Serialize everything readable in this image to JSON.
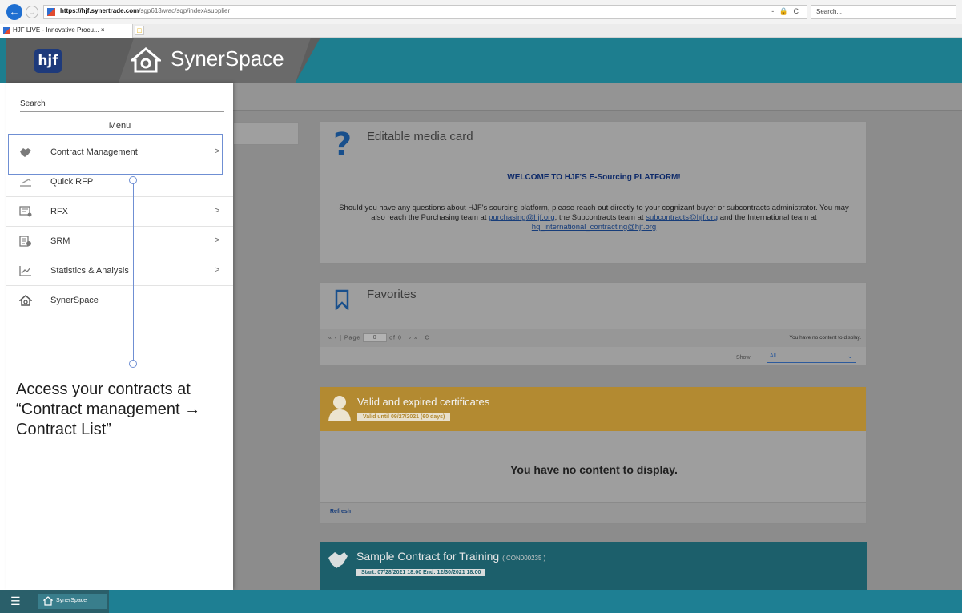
{
  "browser": {
    "url_host": "https://hjf.synertrade.com",
    "url_path": "/sgp613/wac/sqp/index#supplier",
    "address_controls": "- 🔒 C",
    "search_placeholder": "Search...",
    "tab_title": "HJF LIVE - Innovative Procu...",
    "tab_close": "×"
  },
  "header": {
    "logo_text": "hjf",
    "app_title": "SynerSpace",
    "accent_color": "#1d7e8f"
  },
  "side_menu": {
    "search_label": "Search",
    "heading": "Menu",
    "items": [
      {
        "label": "Contract Management",
        "icon": "handshake-icon",
        "has_submenu": true
      },
      {
        "label": "Quick RFP",
        "icon": "quick-rfp-icon",
        "has_submenu": false
      },
      {
        "label": "RFX",
        "icon": "rfx-icon",
        "has_submenu": true
      },
      {
        "label": "SRM",
        "icon": "srm-icon",
        "has_submenu": true
      },
      {
        "label": "Statistics & Analysis",
        "icon": "chart-icon",
        "has_submenu": true
      },
      {
        "label": "SynerSpace",
        "icon": "home-icon",
        "has_submenu": false
      }
    ],
    "chevron": ">"
  },
  "callout": {
    "text": "Access your contracts at\n“Contract management →\nContract List”",
    "color": "#6f8fd3"
  },
  "media_card": {
    "title": "Editable media card",
    "icon_glyph": "?",
    "welcome": "WELCOME TO HJF'S E-Sourcing PLATFORM!",
    "body_1": "Should you have any questions about HJF's sourcing platform, please reach out directly to your cognizant buyer or subcontracts administrator.  You may also reach the Purchasing team at ",
    "link_purchasing": "purchasing@hjf.org",
    "body_2": ", the Subcontracts team at ",
    "link_subcontracts": "subcontracts@hjf.org",
    "body_3": " and the International team at ",
    "link_international": "hq_international_contracting@hjf.org"
  },
  "favorites": {
    "title": "Favorites",
    "pager_nav_first": "«  ‹  |",
    "pager_label": "Page",
    "pager_value": "0",
    "pager_of": "of 0 |",
    "pager_nav_last": "›  »  |  C",
    "empty_message": "You have no content to display.",
    "show_label": "Show:",
    "show_value": "All"
  },
  "certificates": {
    "title": "Valid and expired certificates",
    "badge": "Valid until 09/27/2021 (60 days)",
    "empty_message": "You have no content to display.",
    "refresh_label": "Refresh",
    "header_color": "#b38a31"
  },
  "contract": {
    "title": "Sample Contract for Training",
    "code": "( CON000235 )",
    "dates": "Start:  07/28/2021 18:00    End:  12/30/2021 18:00"
  },
  "taskbar": {
    "app_label": "SynerSpace"
  }
}
